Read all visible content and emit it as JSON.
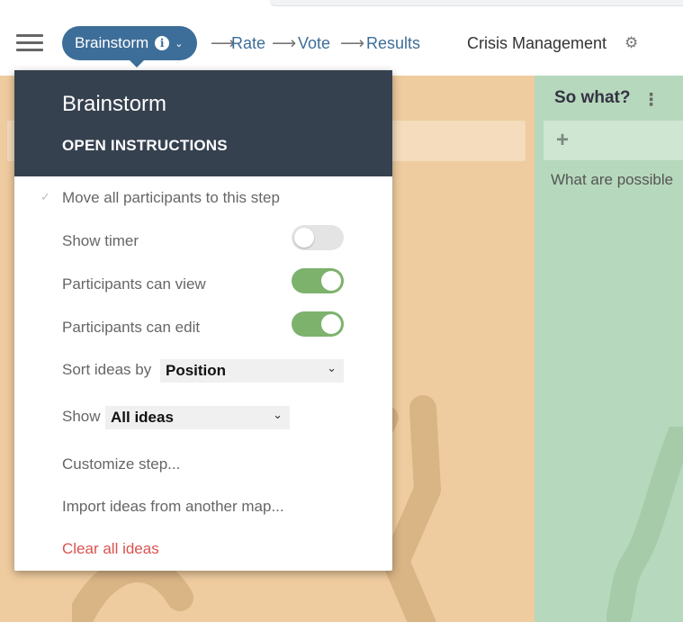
{
  "header": {
    "steps": {
      "current": "Brainstorm",
      "next": [
        "Rate",
        "Vote",
        "Results"
      ]
    },
    "map_title": "Crisis Management"
  },
  "board": {
    "column_right": {
      "title": "So what?",
      "prompt": "What are possible"
    }
  },
  "dropdown": {
    "title": "Brainstorm",
    "open_instructions": "OPEN INSTRUCTIONS",
    "move_participants": "Move all participants to this step",
    "show_timer": {
      "label": "Show timer",
      "on": false
    },
    "participants_can_view": {
      "label": "Participants can view",
      "on": true
    },
    "participants_can_edit": {
      "label": "Participants can edit",
      "on": true
    },
    "sort_by": {
      "label": "Sort ideas by",
      "value": "Position"
    },
    "show": {
      "label": "Show",
      "value": "All ideas"
    },
    "customize": "Customize step...",
    "import": "Import ideas from another map...",
    "clear": "Clear all ideas"
  },
  "colors": {
    "accent": "#3d6e99",
    "panel_header": "#36414f",
    "toggle_on": "#7db26d",
    "danger": "#d9534f",
    "column_orange": "#efcc9f",
    "column_green": "#b6d8bc"
  }
}
